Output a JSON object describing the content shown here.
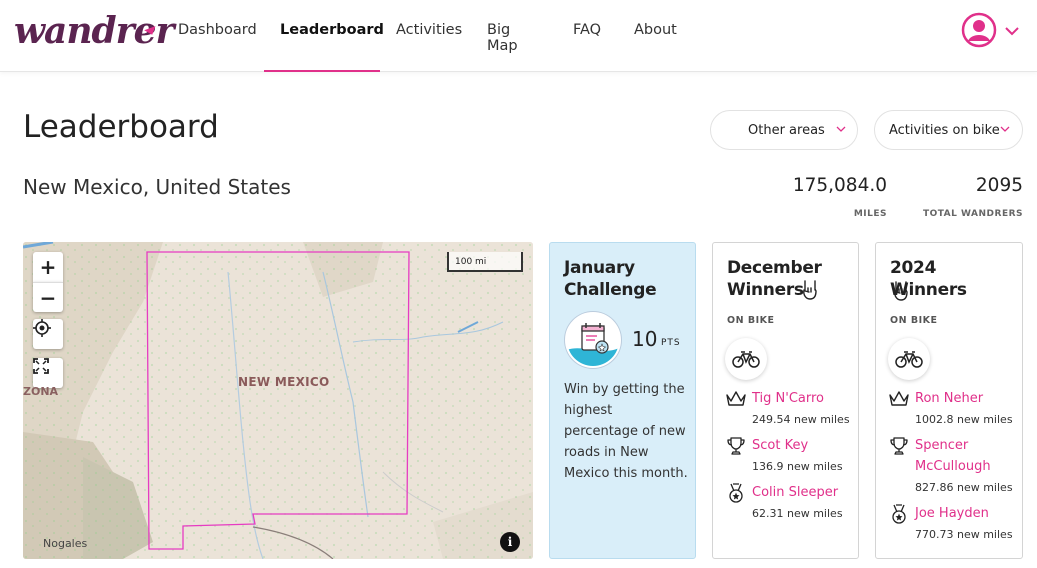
{
  "app": {
    "logo_text": "wandrer"
  },
  "nav": {
    "items": [
      {
        "label": "Dashboard"
      },
      {
        "label": "Leaderboard"
      },
      {
        "label": "Activities"
      },
      {
        "label": "Big Map"
      },
      {
        "label": "FAQ"
      },
      {
        "label": "About"
      }
    ],
    "active": "Leaderboard"
  },
  "header": {
    "title": "Leaderboard",
    "area_dropdown": "Other areas",
    "activity_dropdown": "Activities on bike"
  },
  "area": {
    "name": "New Mexico, United States",
    "miles_value": "175,084.0",
    "miles_label": "MILES",
    "wanderers_value": "2095",
    "wanderers_label": "TOTAL WANDRERS"
  },
  "map": {
    "scale_label": "100 mi",
    "state_label": "NEW MEXICO",
    "left_label": "ZONA",
    "city_label": "Nogales",
    "info_label": "i",
    "zoom_in": "+",
    "zoom_out": "−"
  },
  "challenge": {
    "title": "January Challenge",
    "points": "10",
    "points_label": "PTS",
    "description": "Win by getting the highest percentage of new roads in New Mexico this month."
  },
  "december": {
    "title": "December Winners",
    "subtitle": "ON BIKE",
    "winners": [
      {
        "name": "Tig N'Carro",
        "miles": "249.54 new miles",
        "rank_icon": "crown-icon"
      },
      {
        "name": "Scot Key",
        "miles": "136.9 new miles",
        "rank_icon": "trophy-icon"
      },
      {
        "name": "Colin Sleeper",
        "miles": "62.31 new miles",
        "rank_icon": "medal-icon"
      }
    ]
  },
  "year2024": {
    "title": "2024 Winners",
    "subtitle": "ON BIKE",
    "winners": [
      {
        "name": "Ron Neher",
        "miles": "1002.8 new miles",
        "rank_icon": "crown-icon"
      },
      {
        "name": "Spencer McCullough",
        "miles": "827.86 new miles",
        "rank_icon": "trophy-icon"
      },
      {
        "name": "Joe Hayden",
        "miles": "770.73 new miles",
        "rank_icon": "medal-icon"
      }
    ]
  },
  "colors": {
    "brand": "#5b2450",
    "accent": "#e0308a",
    "challenge_bg": "#d9eef9"
  }
}
